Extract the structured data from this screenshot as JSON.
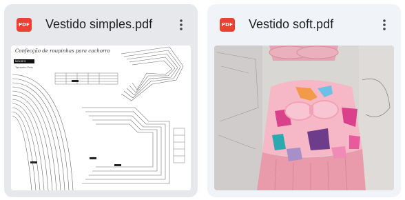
{
  "files": [
    {
      "title": "Vestido simples.pdf",
      "type_badge": "PDF",
      "menu_icon": "more-vert-icon",
      "preview": {
        "heading": "Confecção de roupinhas para cachorro",
        "tag": "MOLDE 8",
        "subtitle": "Tamanho Pets"
      }
    },
    {
      "title": "Vestido soft.pdf",
      "type_badge": "PDF",
      "menu_icon": "more-vert-icon"
    }
  ],
  "colors": {
    "pdf_red": "#e94235",
    "card_selected": "#e6e8ec",
    "card_default": "#f0f4f9",
    "text": "#1f1f1f"
  }
}
